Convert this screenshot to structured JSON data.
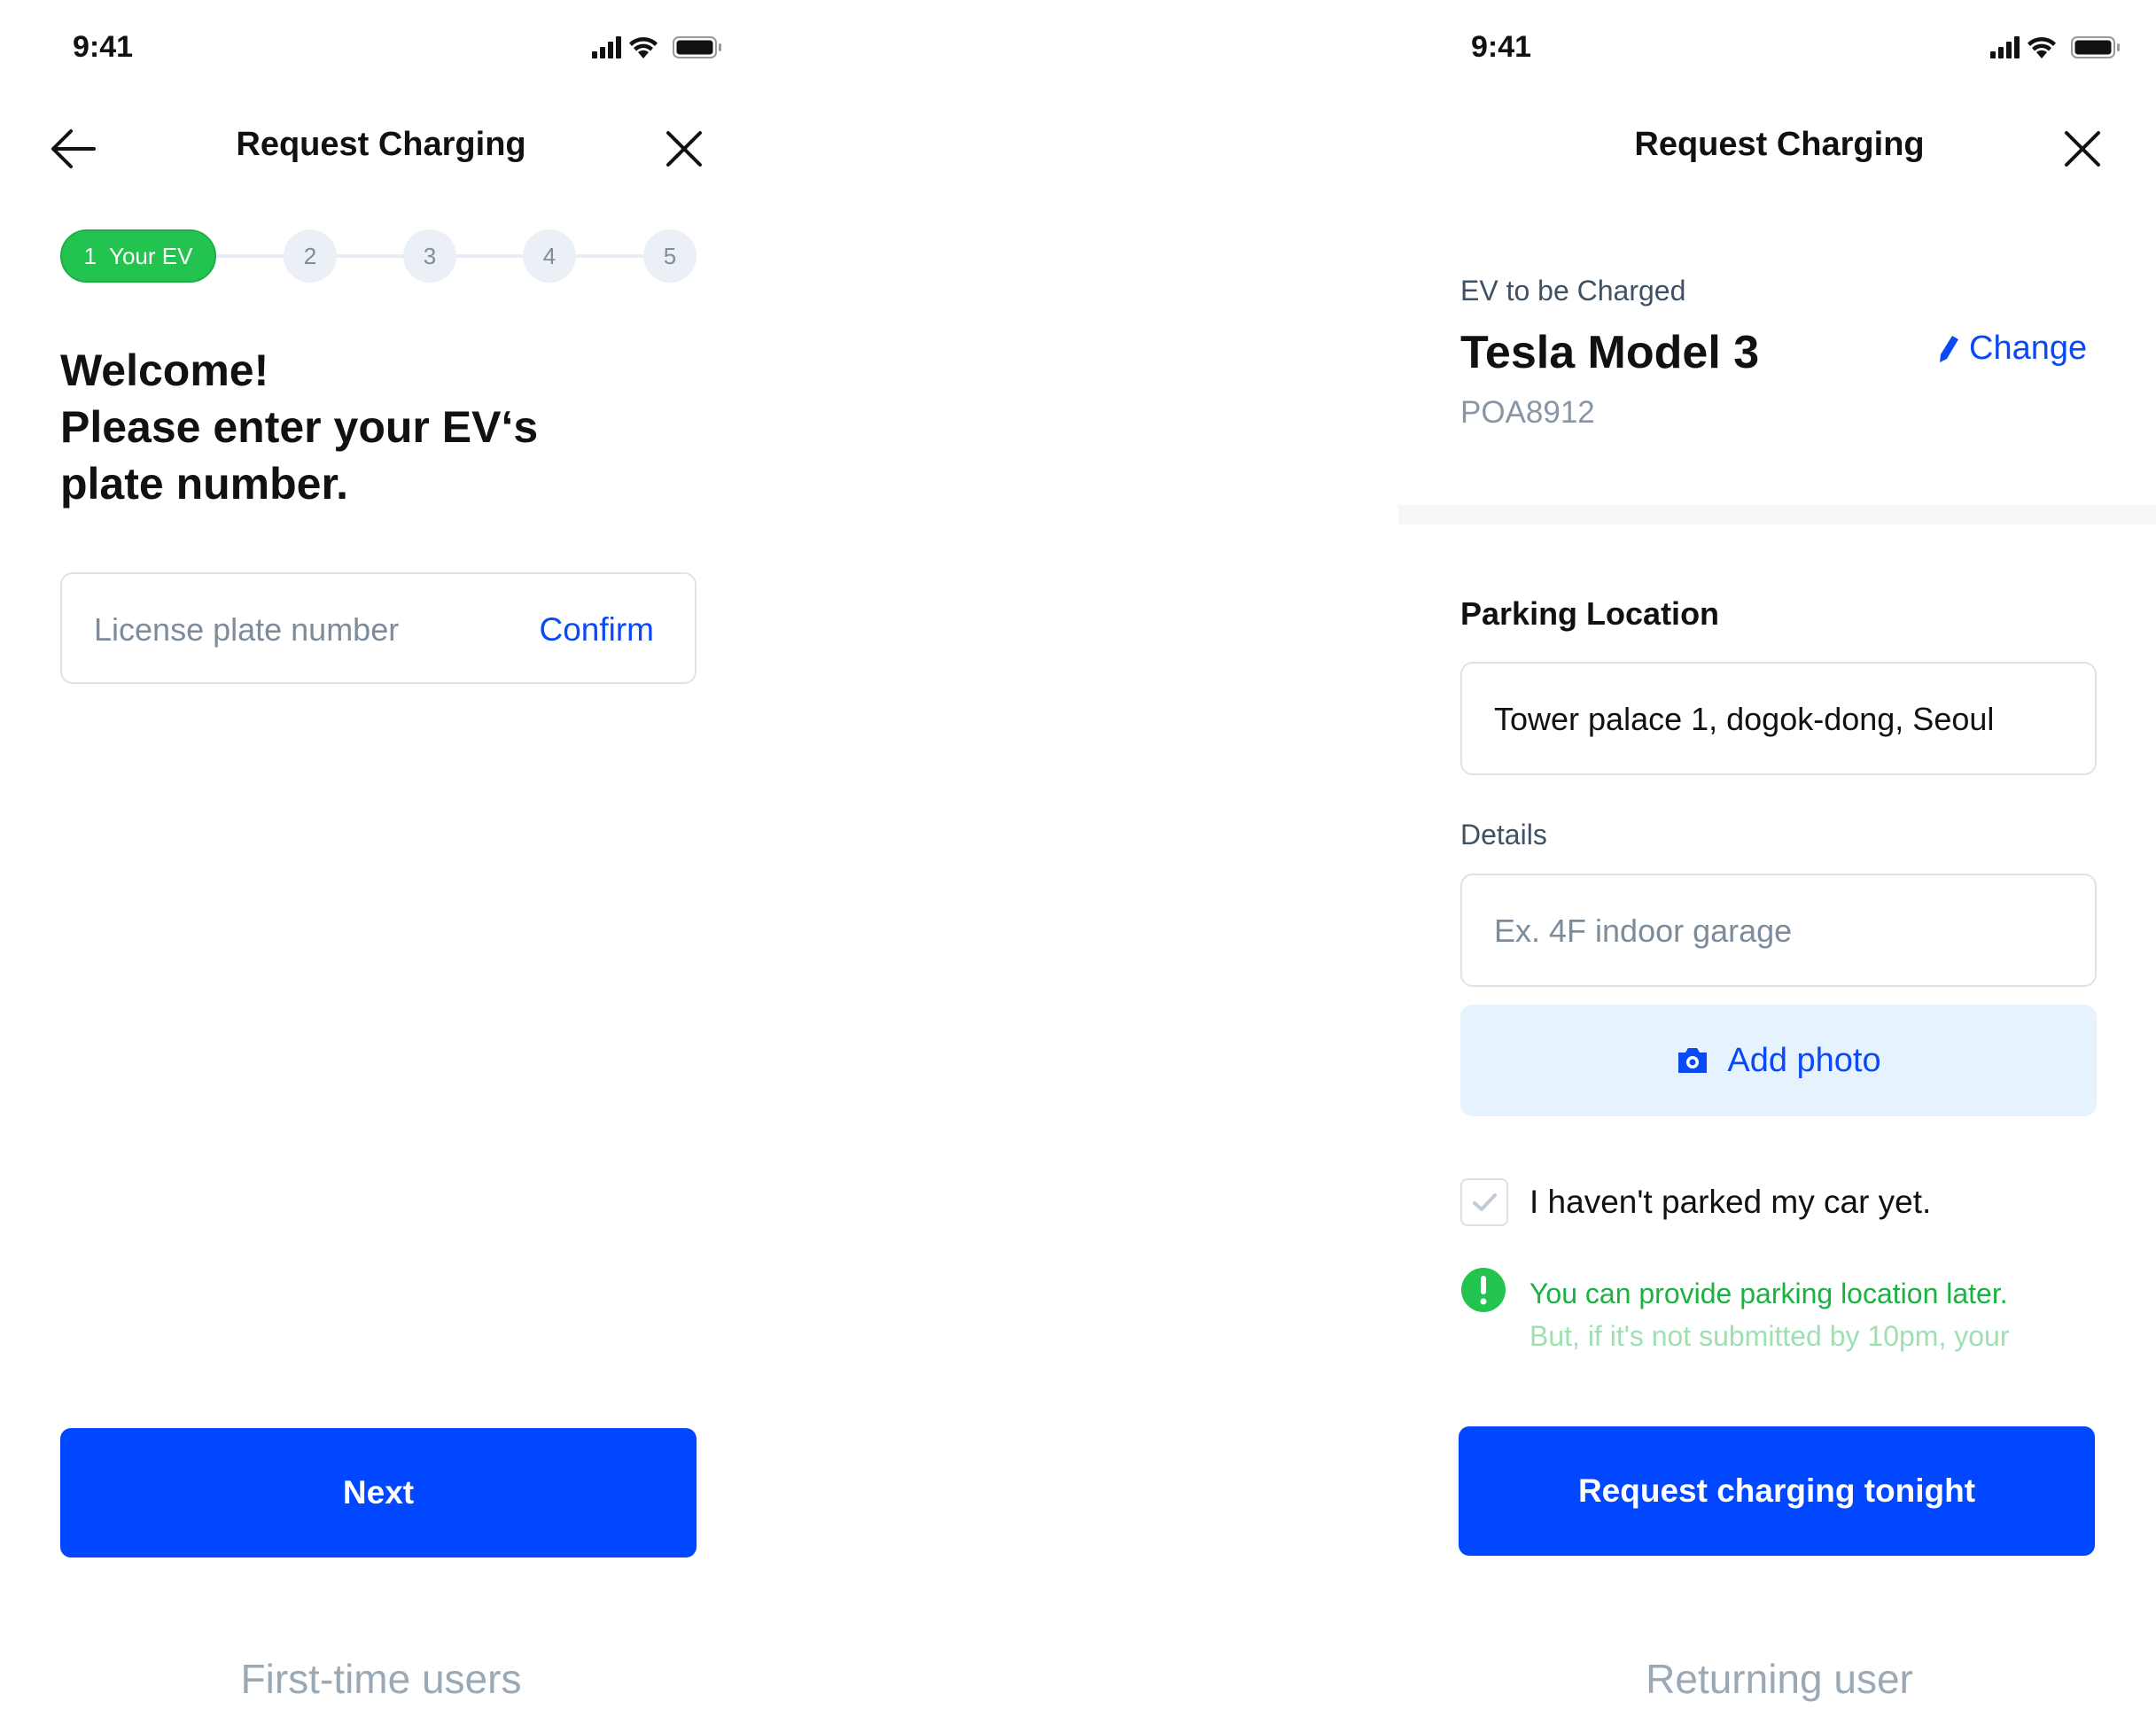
{
  "first_time_screen": {
    "status_time": "9:41",
    "title": "Request Charging",
    "stepper": {
      "active_number": "1",
      "active_label": "Your EV",
      "steps": [
        "2",
        "3",
        "4",
        "5"
      ]
    },
    "welcome_lines": [
      "Welcome!",
      "Please enter your EV‘s",
      "plate number."
    ],
    "plate_input": {
      "placeholder": "License plate number",
      "confirm_label": "Confirm"
    },
    "next_label": "Next",
    "caption": "First-time users"
  },
  "returning_screen": {
    "status_time": "9:41",
    "title": "Request Charging",
    "ev": {
      "label": "EV to be Charged",
      "name": "Tesla Model 3",
      "plate": "POA8912",
      "change_label": "Change"
    },
    "parking": {
      "title": "Parking Location",
      "location_value": "Tower palace 1, dogok-dong, Seoul",
      "details_label": "Details",
      "details_placeholder": "Ex. 4F indoor garage",
      "add_photo_label": "Add photo"
    },
    "not_parked": {
      "label": "I haven't parked my car yet.",
      "checked": false
    },
    "notice": {
      "line1": "You can provide parking location later.",
      "line2": "But, if it's not submitted by 10pm, your"
    },
    "request_label": "Request charging tonight",
    "caption": "Returning user"
  },
  "colors": {
    "primary": "#0047ff",
    "link": "#0a4af5",
    "success": "#22c34e",
    "caption": "#9aa9b6",
    "photo_bg": "#e6f3fe"
  },
  "icons": [
    "back-arrow-icon",
    "close-icon",
    "pencil-icon",
    "camera-icon",
    "check-icon",
    "exclamation-icon",
    "signal-icon",
    "wifi-icon",
    "battery-icon"
  ]
}
